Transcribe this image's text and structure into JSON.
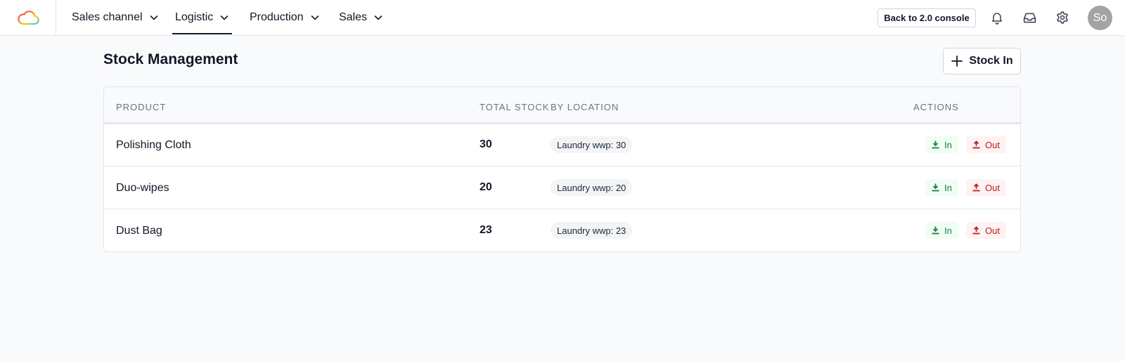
{
  "nav": {
    "items": [
      {
        "label": "Sales channel"
      },
      {
        "label": "Logistic"
      },
      {
        "label": "Production"
      },
      {
        "label": "Sales"
      }
    ],
    "active": "Logistic",
    "console_button": "Back to 2.0 console",
    "avatar_initials": "So"
  },
  "icons": {
    "logo": "cloud-logo-icon",
    "notifications": "bell-icon",
    "inbox": "inbox-icon",
    "settings": "gear-icon",
    "stock_in": "plus-icon",
    "in_action": "download-icon",
    "out_action": "upload-icon"
  },
  "page": {
    "title": "Stock Management",
    "stock_in_button": "Stock In"
  },
  "table": {
    "headers": {
      "product": "PRODUCT",
      "total_stock": "TOTAL STOCK",
      "by_location": "BY LOCATION",
      "actions": "ACTIONS"
    },
    "rows": [
      {
        "product": "Polishing Cloth",
        "total": "30",
        "location": "Laundry wwp: 30",
        "in_label": "In",
        "out_label": "Out"
      },
      {
        "product": "Duo-wipes",
        "total": "20",
        "location": "Laundry wwp: 20",
        "in_label": "In",
        "out_label": "Out"
      },
      {
        "product": "Dust Bag",
        "total": "23",
        "location": "Laundry wwp: 23",
        "in_label": "In",
        "out_label": "Out"
      }
    ]
  },
  "colors": {
    "in_text": "#15803d",
    "in_bg": "#f0fdf4",
    "out_text": "#b91c1c",
    "out_bg": "#fef2f2",
    "page_bg": "#f9fafb"
  }
}
